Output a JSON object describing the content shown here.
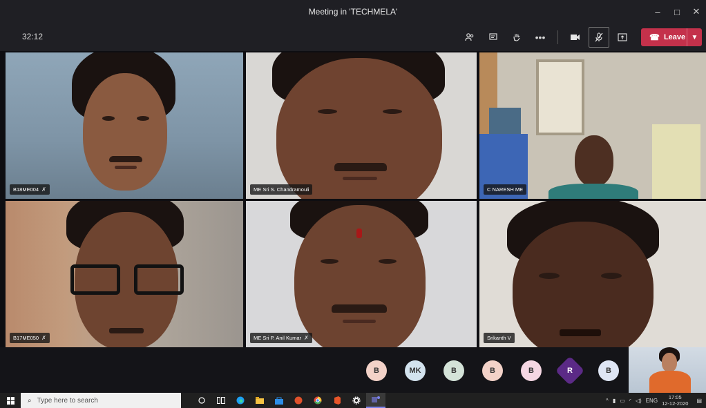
{
  "window": {
    "title": "Meeting in 'TECHMELA'",
    "controls": {
      "minimize": "–",
      "maximize": "□",
      "close": "✕"
    }
  },
  "toolbar": {
    "timer": "32:12",
    "icons": [
      "participants-icon",
      "chat-icon",
      "raise-hand-icon",
      "more-icon",
      "camera-icon",
      "mic-muted-icon",
      "share-icon"
    ],
    "leave_label": "Leave",
    "leave_color": "#c4314b"
  },
  "participants": [
    {
      "name": "B18ME004",
      "muted": true
    },
    {
      "name": "ME Sri S. Chandramouli",
      "muted": false
    },
    {
      "name": "C NARESH ME",
      "muted": false
    },
    {
      "name": "B17ME050",
      "muted": true
    },
    {
      "name": "ME Sri P. Anil Kumar",
      "muted": true
    },
    {
      "name": "Srikanth V",
      "muted": false
    }
  ],
  "overflow_avatars": [
    {
      "initials": "B",
      "color": "#f3d2c8"
    },
    {
      "initials": "MK",
      "color": "#d3e3ee"
    },
    {
      "initials": "B",
      "color": "#d4e3d8"
    },
    {
      "initials": "B",
      "color": "#f3d2c8"
    },
    {
      "initials": "B",
      "color": "#f5d7e3"
    },
    {
      "initials": "R",
      "color": "#5b2a86"
    },
    {
      "initials": "B",
      "color": "#dfe6f5"
    }
  ],
  "taskbar": {
    "search_placeholder": "Type here to search",
    "lang": "ENG",
    "time": "17:05",
    "date": "12-12-2020"
  }
}
